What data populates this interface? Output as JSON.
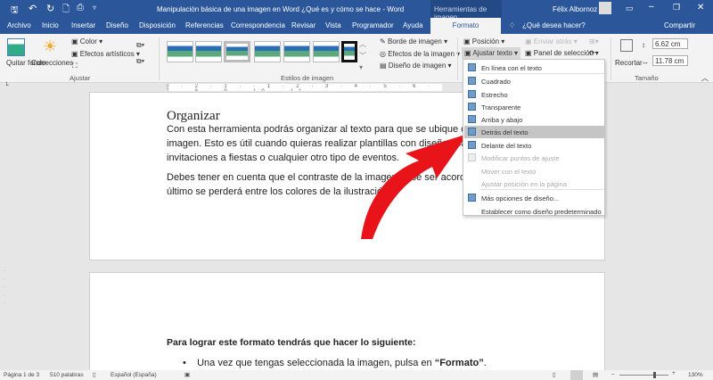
{
  "title": "Manipulación básica de una imagen en Word ¿Qué es y cómo se hace - Word",
  "context_tab": "Herramientas de imagen",
  "user": "Félix Albornoz",
  "tabs": [
    "Archivo",
    "Inicio",
    "Insertar",
    "Diseño",
    "Disposición",
    "Referencias",
    "Correspondencia",
    "Revisar",
    "Vista",
    "Programador",
    "Ayuda",
    "Formato"
  ],
  "tell_me": "¿Qué desea hacer?",
  "share": "Compartir",
  "ribbon": {
    "quitar_fondo": "Quitar fondo",
    "correcciones": "Correcciones",
    "color": "Color",
    "efectos": "Efectos artísticos",
    "ajustar_group": "Ajustar",
    "estilos_group": "Estilos de imagen",
    "borde": "Borde de imagen",
    "efectos_imagen": "Efectos de la imagen",
    "diseno": "Diseño de imagen",
    "posicion": "Posición",
    "ajustar_texto": "Ajustar texto",
    "enviar_atras": "Enviar atrás",
    "panel": "Panel de selección",
    "recortar": "Recortar",
    "alto": "6.62 cm",
    "ancho": "11.78 cm",
    "tamano_group": "Tamaño"
  },
  "ruler_text": "3 · 2 · 1 · · 1 · 2 · 3 · 4 · 5 · 6 · 7 · 8 · 9 · 10 · 11",
  "document": {
    "heading": "Organizar",
    "p1": [
      "Con esta herramienta podrás organizar al texto para que se ubique delant",
      "imagen. Esto es útil cuando quieras realizar plantillas con diseños para",
      "invitaciones a fiestas o cualquier otro tipo de eventos."
    ],
    "p2": [
      "Debes tener en cuenta que el contraste de la imagen debe ser acorde con",
      "último se perderá entre los colores de la ilustración."
    ],
    "p3": "Para lograr este formato tendrás que hacer lo siguiente:",
    "bullet_pre": "Una vez que tengas seleccionada la imagen, pulsa en ",
    "bullet_bold": "“Formato”",
    "bullet_post": "."
  },
  "menu": [
    {
      "label": "En línea con el texto",
      "state": "normal"
    },
    {
      "label": "Cuadrado",
      "state": "normal"
    },
    {
      "label": "Estrecho",
      "state": "normal"
    },
    {
      "label": "Transparente",
      "state": "normal"
    },
    {
      "label": "Arriba y abajo",
      "state": "normal"
    },
    {
      "label": "Detrás del texto",
      "state": "selected"
    },
    {
      "label": "Delante del texto",
      "state": "normal"
    },
    {
      "label": "Modificar puntos de ajuste",
      "state": "disabled"
    },
    {
      "label": "Mover con el texto",
      "state": "disabled"
    },
    {
      "label": "Ajustar posición en la página",
      "state": "disabled"
    },
    {
      "label": "Más opciones de diseño...",
      "state": "normal"
    },
    {
      "label": "Establecer como diseño predeterminado",
      "state": "normal"
    }
  ],
  "status": {
    "page": "Página 1 de 3",
    "words": "510 palabras",
    "lang": "Español (España)",
    "zoom": "130%"
  },
  "colors": {
    "brand": "#2b579a",
    "arrow": "#e8141a"
  }
}
